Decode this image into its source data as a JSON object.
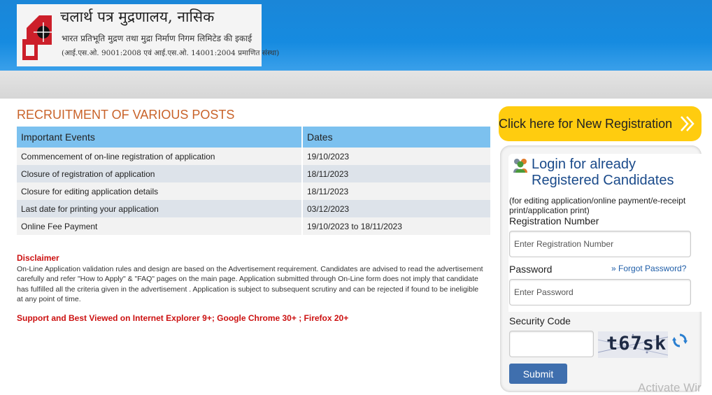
{
  "header": {
    "logo_line1": "चलार्थ पत्र मुद्रणालय, नासिक",
    "logo_line2": "भारत प्रतिभूति मुद्रण तथा मुद्रा निर्माण निगम लिमिटेड की इकाई",
    "logo_line3": "(आई.एस.ओ. 9001:2008 एवं आई.एस.ओ. 14001:2004 प्रमाणित संस्था)",
    "colors": {
      "bar": "#1a86d8",
      "logo_red": "#cc1f2a"
    }
  },
  "main": {
    "title": "RECRUITMENT OF VARIOUS POSTS",
    "table": {
      "headers": [
        "Important Events",
        "Dates"
      ],
      "rows": [
        [
          "Commencement of on-line registration of application",
          "19/10/2023"
        ],
        [
          "Closure of registration of application",
          "18/11/2023"
        ],
        [
          "Closure for editing application details",
          "18/11/2023"
        ],
        [
          "Last date for printing your application",
          "03/12/2023"
        ],
        [
          "Online Fee Payment",
          "19/10/2023 to 18/11/2023"
        ]
      ]
    },
    "disclaimer_title": "Disclaimer",
    "disclaimer_text": "On-Line Application validation rules and design are based on the Advertisement requirement. Candidates are advised to read the advertisement carefully and refer \"How to Apply\" & \"FAQ\" pages on the main page. Application submitted through On-Line form does not imply that candidate has fulfilled all the criteria given in the advertisement . Application is subject to subsequent scrutiny and can be rejected if found to be ineligible at any point of time.",
    "support_text": "Support and Best Viewed on Internet Explorer 9+; Google Chrome 30+ ; Firefox 20+"
  },
  "sidebar": {
    "new_registration": {
      "label": "Click here for New Registration",
      "icon": "double-chevron-right-icon",
      "color": "#ffcc0f"
    },
    "login": {
      "title_line1": "Login for already",
      "title_line2": "Registered Candidates",
      "subtitle": "(for editing application/online payment/e-receipt print/application print)",
      "reg_label": "Registration Number",
      "reg_placeholder": "Enter Registration Number",
      "password_label": "Password",
      "forgot_label": "Forgot Password?",
      "password_placeholder": "Enter Password",
      "security_label": "Security Code",
      "captcha_text": "t67sk",
      "submit_label": "Submit"
    }
  },
  "watermark": "Activate Wir"
}
